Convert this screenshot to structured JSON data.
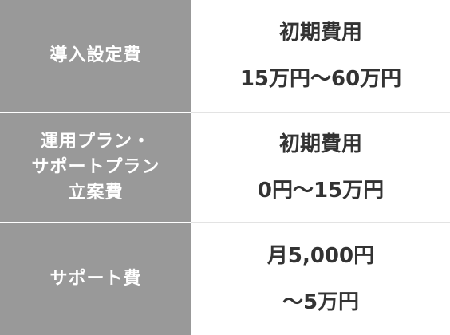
{
  "rows": [
    {
      "label_lines": [
        "導入設定費"
      ],
      "value_lines": [
        "初期費用",
        "15万円〜60万円"
      ]
    },
    {
      "label_lines": [
        "運用プラン・",
        "サポートプラン",
        "立案費"
      ],
      "value_lines": [
        "初期費用",
        "0円〜15万円"
      ]
    },
    {
      "label_lines": [
        "サポート費"
      ],
      "value_lines": [
        "月5,000円",
        "〜5万円"
      ]
    }
  ],
  "colors": {
    "label_background": "#999999",
    "label_text": "#ffffff",
    "value_background": "#ffffff",
    "value_text": "#333333",
    "divider": "#e3e3e3"
  }
}
